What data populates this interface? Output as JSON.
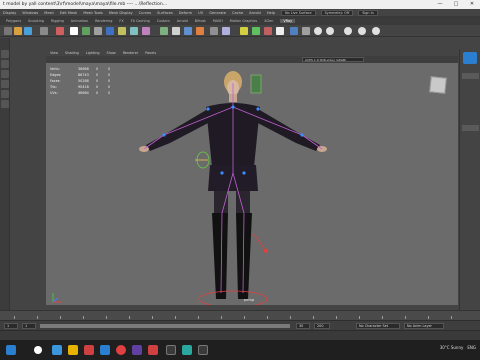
{
  "titlebar": {
    "title": "t model by yall content\\3\\rf\\model\\maya\\maya\\file.mb  ----  ...\\Reflection..."
  },
  "menubar": {
    "items": [
      "Display",
      "Windows",
      "Mesh",
      "Edit Mesh",
      "Mesh Tools",
      "Mesh Display",
      "Curves",
      "Surfaces",
      "Deform",
      "UV",
      "Generate",
      "Cache",
      "Arnold",
      "Help"
    ],
    "no_live_surface": "No Live Surface",
    "symmetry": "Symmetry: Off",
    "sign_in": "Sign In"
  },
  "shelf_tabs": {
    "items": [
      "Polygons",
      "Sculpting",
      "Rigging",
      "Animation",
      "Rendering",
      "FX",
      "FX Caching",
      "Custom",
      "Arnold",
      "Bifrost",
      "MASH",
      "Motion Graphics",
      "XGen",
      "VRay"
    ],
    "active_index": 13
  },
  "viewport": {
    "menu": [
      "View",
      "Shading",
      "Lighting",
      "Show",
      "Renderer",
      "Panels"
    ],
    "hud": [
      {
        "label": "Verts:",
        "value": "36668",
        "a": "0",
        "b": "0"
      },
      {
        "label": "Edges:",
        "value": "86743",
        "a": "0",
        "b": "0"
      },
      {
        "label": "Faces:",
        "value": "50288",
        "a": "0",
        "b": "0"
      },
      {
        "label": "Tris:",
        "value": "90418",
        "a": "0",
        "b": "0"
      },
      {
        "label": "UVs:",
        "value": "46664",
        "a": "0",
        "b": "0"
      }
    ],
    "camera_label": "persp",
    "gamma": "ACES 1.0 SDR-video (sRGB)"
  },
  "rangebar": {
    "start": "1",
    "end": "30",
    "range_start": "1",
    "range_end": "200",
    "character_set": "No Character Set",
    "anim_layer": "No Anim Layer"
  },
  "taskbar": {
    "weather": "30°C  Sunny",
    "lang": "ENG"
  },
  "colors": {
    "viewport_bg": "#6b6b6b",
    "maya_ui": "#444444",
    "accent_blue": "#2a7fd1"
  }
}
